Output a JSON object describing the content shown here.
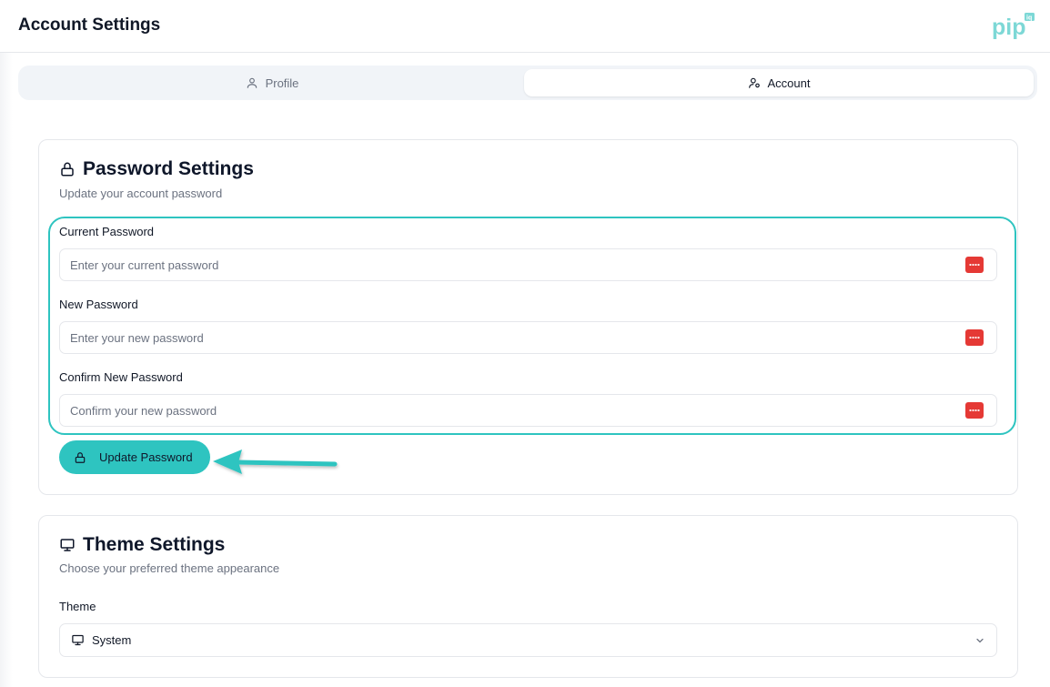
{
  "header": {
    "title": "Account Settings",
    "logo_text": "pip",
    "logo_badge": "iq"
  },
  "tabs": [
    {
      "label": "Profile",
      "icon": "user-icon",
      "active": false
    },
    {
      "label": "Account",
      "icon": "user-settings-icon",
      "active": true
    }
  ],
  "password": {
    "title": "Password Settings",
    "subtitle": "Update your account password",
    "fields": [
      {
        "label": "Current Password",
        "placeholder": "Enter your current password",
        "value": ""
      },
      {
        "label": "New Password",
        "placeholder": "Enter your new password",
        "value": ""
      },
      {
        "label": "Confirm New Password",
        "placeholder": "Confirm your new password",
        "value": ""
      }
    ],
    "button_label": "Update Password"
  },
  "theme": {
    "title": "Theme Settings",
    "subtitle": "Choose your preferred theme appearance",
    "label": "Theme",
    "selected": "System"
  },
  "colors": {
    "accent": "#2ec4c0",
    "password_manager": "#e53935"
  }
}
